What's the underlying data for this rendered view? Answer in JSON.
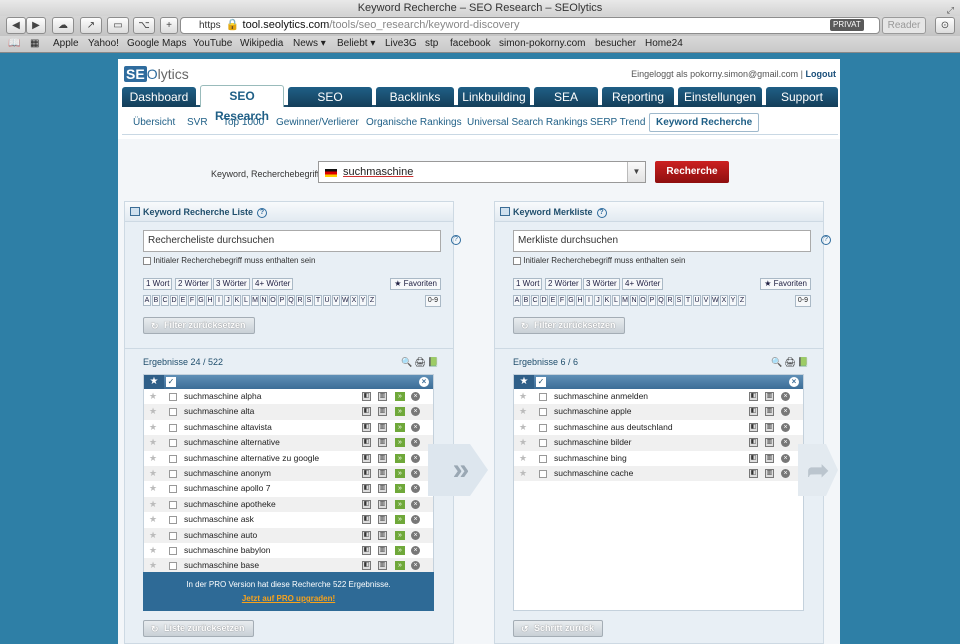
{
  "browser": {
    "title": "Keyword Recherche – SEO Research – SEOlytics",
    "url_scheme": "https",
    "url_domain": "tool.seolytics.com",
    "url_path": "/tools/seo_research/keyword-discovery",
    "privat": "PRIVAT",
    "reader": "Reader",
    "bookmarks": [
      "Apple",
      "Yahoo!",
      "Google Maps",
      "YouTube",
      "Wikipedia",
      "News ▾",
      "Beliebt ▾",
      "Live3G",
      "stp",
      "facebook",
      "simon-pokorny.com",
      "besucher",
      "Home24"
    ]
  },
  "header": {
    "logo_se": "SE",
    "logo_o": "O",
    "logo_rest": "lytics",
    "login_text": "Eingeloggt als pokorny.simon@gmail.com |",
    "logout": "Logout"
  },
  "nav": {
    "tabs": [
      "Dashboard",
      "SEO Research",
      "SEO Monitoring",
      "Backlinks",
      "Linkbuilding",
      "SEA",
      "Reporting",
      "Einstellungen",
      "Support"
    ],
    "active": "SEO Research"
  },
  "subnav": {
    "items": [
      "Übersicht",
      "SVR",
      "Top 1000",
      "Gewinner/Verlierer",
      "Organische Rankings",
      "Universal Search Rankings",
      "SERP Trend",
      "Keyword Recherche"
    ],
    "active": "Keyword Recherche"
  },
  "keyword": {
    "label": "Keyword, Recherchebegriff",
    "value": "suchmaschine",
    "button": "Recherche"
  },
  "left_panel": {
    "title": "Keyword Recherche Liste",
    "search_placeholder": "Rechercheliste durchsuchen",
    "initial_label": "Initialer Recherchebegriff muss enthalten sein",
    "word_filters": [
      "1 Wort",
      "2 Wörter",
      "3 Wörter",
      "4+ Wörter"
    ],
    "favorites": "★ Favoriten",
    "zero9": "0-9",
    "reset_filter": "Filter zurücksetzen",
    "results": "Ergebnisse 24 / 522",
    "rows": [
      "suchmaschine alpha",
      "suchmaschine alta",
      "suchmaschine altavista",
      "suchmaschine alternative",
      "suchmaschine alternative zu google",
      "suchmaschine anonym",
      "suchmaschine apollo 7",
      "suchmaschine apotheke",
      "suchmaschine ask",
      "suchmaschine auto",
      "suchmaschine babylon",
      "suchmaschine base"
    ],
    "pro_line1": "In der PRO Version hat diese Recherche 522 Ergebnisse.",
    "pro_line2": "Jetzt auf PRO upgraden!",
    "reset_list": "Liste zurücksetzen"
  },
  "right_panel": {
    "title": "Keyword Merkliste",
    "search_placeholder": "Merkliste durchsuchen",
    "initial_label": "Initialer Recherchebegriff muss enthalten sein",
    "word_filters": [
      "1 Wort",
      "2 Wörter",
      "3 Wörter",
      "4+ Wörter"
    ],
    "favorites": "★ Favoriten",
    "zero9": "0-9",
    "reset_filter": "Filter zurücksetzen",
    "results": "Ergebnisse 6 / 6",
    "rows": [
      "suchmaschine anmelden",
      "suchmaschine apple",
      "suchmaschine aus deutschland",
      "suchmaschine bilder",
      "suchmaschine bing",
      "suchmaschine cache"
    ],
    "step_back": "Schritt zurück"
  },
  "letters": [
    "A",
    "B",
    "C",
    "D",
    "E",
    "F",
    "G",
    "H",
    "I",
    "J",
    "K",
    "L",
    "M",
    "N",
    "O",
    "P",
    "Q",
    "R",
    "S",
    "T",
    "U",
    "V",
    "W",
    "X",
    "Y",
    "Z"
  ],
  "colors": {
    "background": "#2e7fa6",
    "nav": "#1f5f86",
    "accent_red": "#b81a1a",
    "pro_box": "#2e6a96",
    "upgrade": "#f7a21b"
  }
}
